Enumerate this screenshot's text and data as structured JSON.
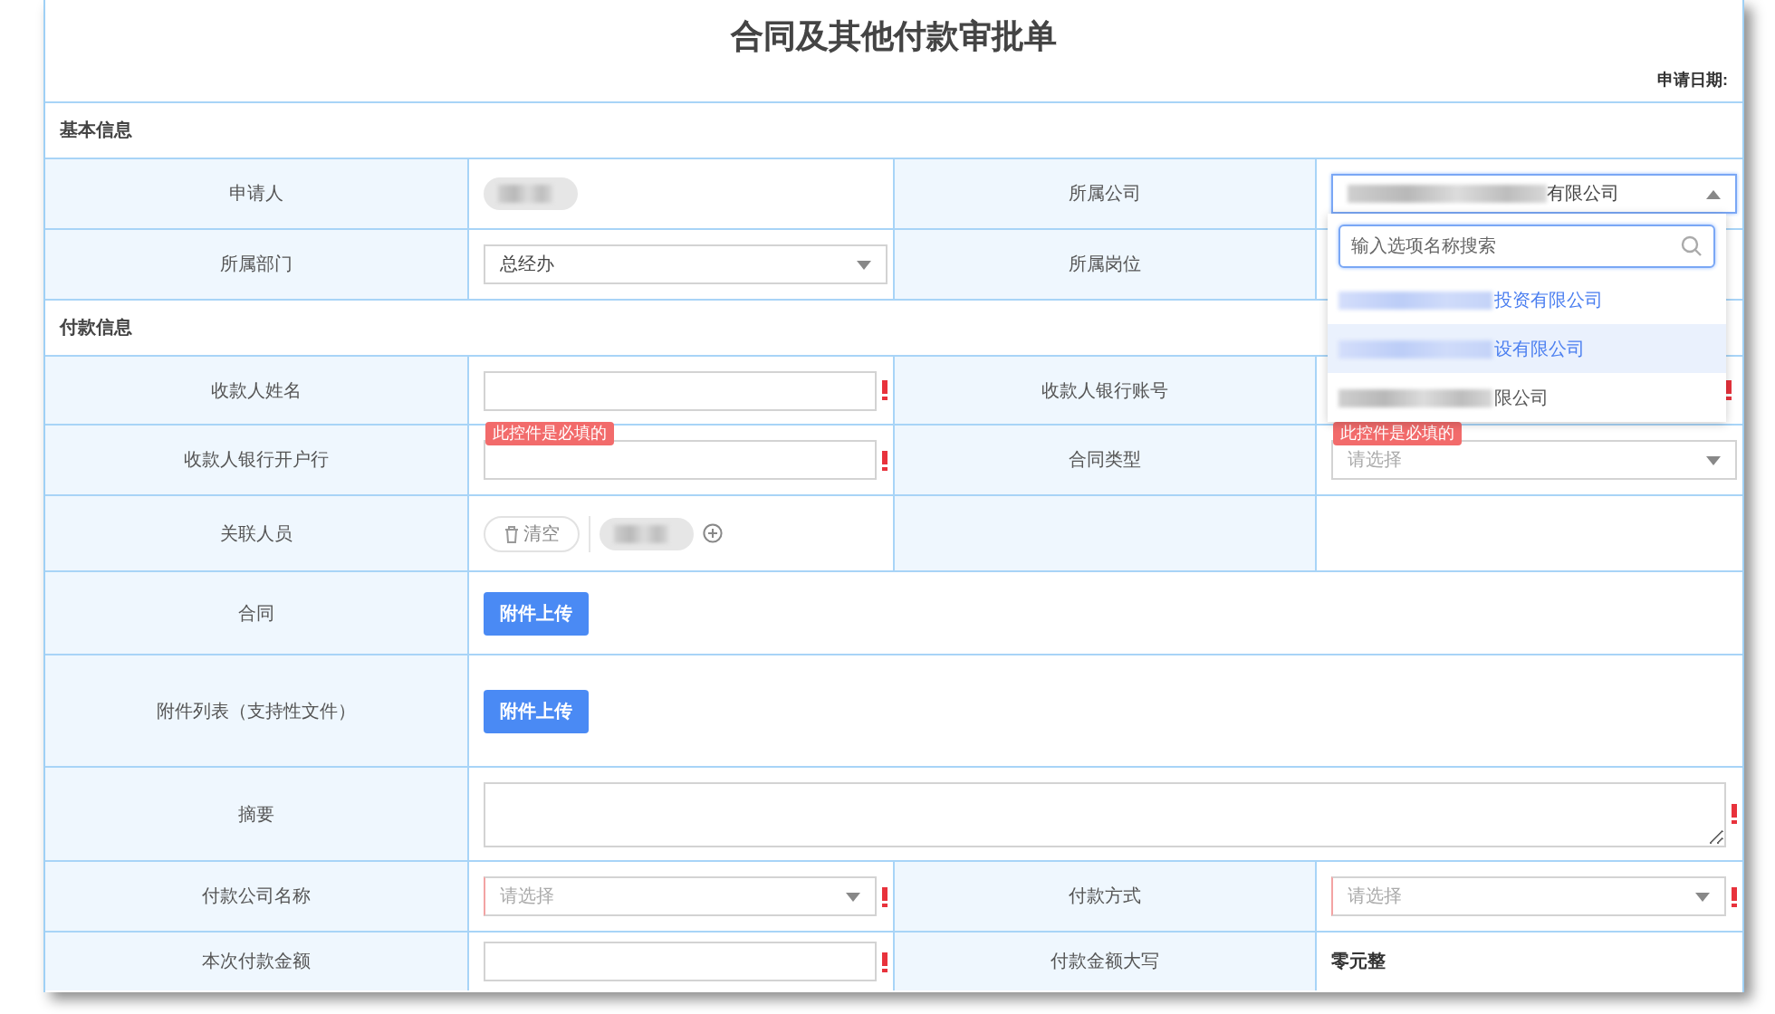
{
  "title": "合同及其他付款审批单",
  "apply_date_label": "申请日期:",
  "sections": [
    {
      "title": "基本信息",
      "rows": [
        [
          {
            "kind": "label",
            "text": "申请人"
          },
          {
            "kind": "person"
          },
          {
            "kind": "label",
            "text": "所属公司"
          },
          {
            "kind": "select",
            "value": "有限公司",
            "redacted": true,
            "open": true
          }
        ],
        [
          {
            "kind": "label",
            "text": "所属部门"
          },
          {
            "kind": "select",
            "value": "总经办"
          },
          {
            "kind": "label",
            "text": "所属岗位"
          },
          {
            "kind": "covered"
          }
        ]
      ]
    },
    {
      "title": "付款信息",
      "rows": [
        [
          {
            "kind": "label",
            "text": "收款人姓名"
          },
          {
            "kind": "input",
            "required": true,
            "error": "此控件是必填的"
          },
          {
            "kind": "label",
            "text": "收款人银行账号"
          },
          {
            "kind": "covered",
            "required": true,
            "error": "此控件是必填的"
          }
        ],
        [
          {
            "kind": "label",
            "text": "收款人银行开户行"
          },
          {
            "kind": "input",
            "required": true
          },
          {
            "kind": "label",
            "text": "合同类型"
          },
          {
            "kind": "select",
            "placeholder": "请选择"
          }
        ],
        [
          {
            "kind": "label",
            "text": "关联人员"
          },
          {
            "kind": "people",
            "clear": "清空"
          },
          {
            "kind": "label",
            "text": ""
          },
          {
            "kind": "blank"
          }
        ],
        [
          {
            "kind": "label",
            "text": "合同"
          },
          {
            "kind": "upload",
            "button": "附件上传",
            "wide": true
          }
        ],
        [
          {
            "kind": "label",
            "text": "附件列表（支持性文件）"
          },
          {
            "kind": "upload",
            "button": "附件上传",
            "wide": true
          }
        ],
        [
          {
            "kind": "label",
            "text": "摘要"
          },
          {
            "kind": "textarea",
            "required": true,
            "wide": true
          }
        ],
        [
          {
            "kind": "label",
            "text": "付款公司名称"
          },
          {
            "kind": "select",
            "placeholder": "请选择",
            "required": true
          },
          {
            "kind": "label",
            "text": "付款方式"
          },
          {
            "kind": "select",
            "placeholder": "请选择",
            "required": true
          }
        ],
        [
          {
            "kind": "label",
            "text": "本次付款金额"
          },
          {
            "kind": "input",
            "required": true
          },
          {
            "kind": "label",
            "text": "付款金额大写"
          },
          {
            "kind": "text",
            "text": "零元整"
          }
        ]
      ]
    }
  ],
  "dropdown": {
    "search_placeholder": "输入选项名称搜索",
    "options": [
      {
        "text": "投资有限公司",
        "redacted": true,
        "active": true,
        "hovered": false
      },
      {
        "text": "设有限公司",
        "redacted": true,
        "active": true,
        "hovered": true
      },
      {
        "text": "限公司",
        "redacted": true,
        "active": false,
        "hovered": false
      }
    ]
  }
}
